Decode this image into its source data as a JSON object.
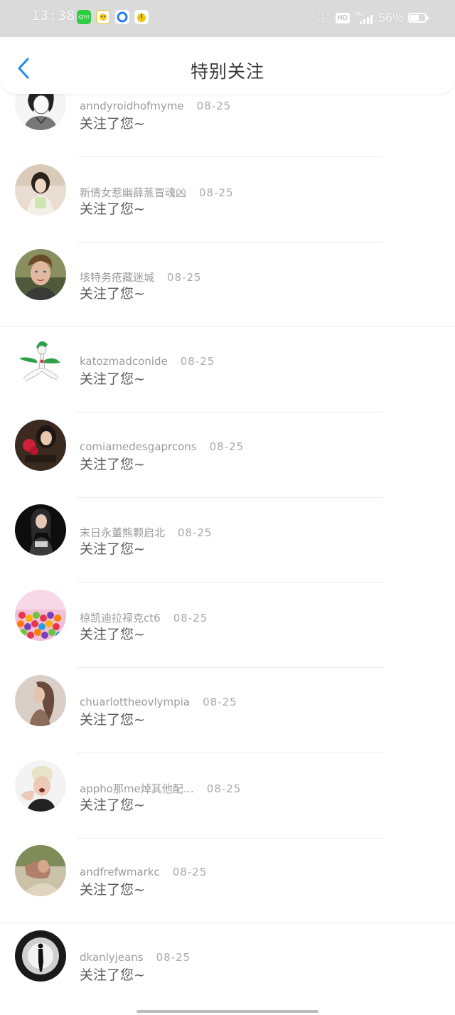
{
  "status_bar": {
    "time": "13:38",
    "apps": [
      {
        "icon": "iqiyi-icon",
        "label": "iQIYI",
        "color": "#2ecc40"
      },
      {
        "icon": "qmusic-icon",
        "label": "",
        "color": "#f5c518"
      },
      {
        "icon": "browser-icon",
        "label": "",
        "color": "#2a7df0"
      },
      {
        "icon": "qqmusic-icon",
        "label": "",
        "color": "#f2c40f"
      }
    ],
    "net_speed_value": "1.00",
    "net_speed_unit": "KB/s",
    "hd": "HD",
    "network": "5G",
    "battery": "56%",
    "battery_level": 0.56
  },
  "header": {
    "back_icon": "chevron-left-icon",
    "title": "特别关注",
    "accent": "#1f8cf0"
  },
  "list": [
    {
      "username": "anndyroidhofmyme",
      "date": "08-25",
      "action": "关注了您~"
    },
    {
      "username": "新倩女惹幽薛蒸冒魂凶",
      "date": "08-25",
      "action": "关注了您~"
    },
    {
      "username": "垓特务疮藏迷城",
      "date": "08-25",
      "action": "关注了您~"
    },
    {
      "username": "katozmadconide",
      "date": "08-25",
      "action": "关注了您~"
    },
    {
      "username": "comiamedesgaprcons",
      "date": "08-25",
      "action": "关注了您~"
    },
    {
      "username": "末日永董熊颗启北",
      "date": "08-25",
      "action": "关注了您~"
    },
    {
      "username": "椋凯迪拉禄克ct6",
      "date": "08-25",
      "action": "关注了您~"
    },
    {
      "username": "chuarlottheovlympia",
      "date": "08-25",
      "action": "关注了您~"
    },
    {
      "username": "appho那me焯其他配…",
      "date": "08-25",
      "action": "关注了您~"
    },
    {
      "username": "andfrefwmarkc",
      "date": "08-25",
      "action": "关注了您~"
    },
    {
      "username": "dkanlyjeans",
      "date": "08-25",
      "action": "关注了您~"
    }
  ]
}
